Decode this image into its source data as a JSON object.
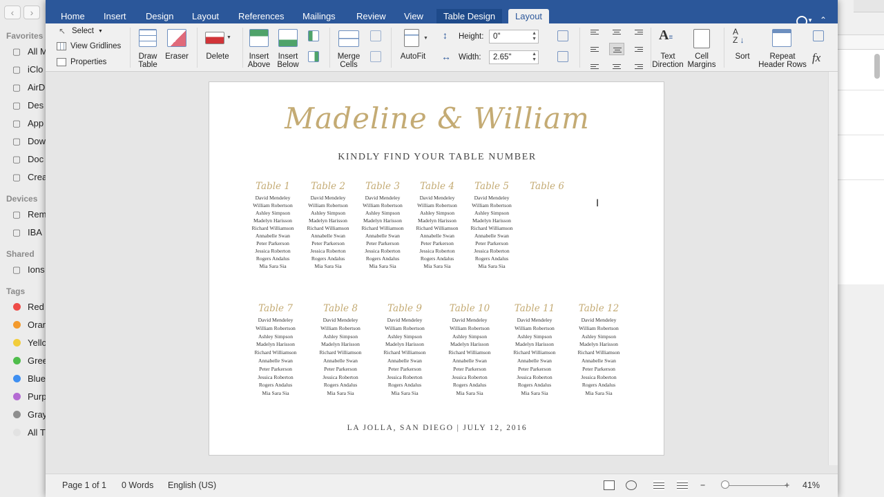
{
  "finder": {
    "sections": {
      "favorites": "Favorites",
      "devices": "Devices",
      "shared": "Shared",
      "tags": "Tags"
    },
    "favorites": [
      {
        "label": "All M",
        "icon": "all-files-icon"
      },
      {
        "label": "iClo",
        "icon": "icloud-icon"
      },
      {
        "label": "AirD",
        "icon": "airdrop-icon"
      },
      {
        "label": "Des",
        "icon": "desktop-icon"
      },
      {
        "label": "App",
        "icon": "applications-icon"
      },
      {
        "label": "Dow",
        "icon": "downloads-icon"
      },
      {
        "label": "Doc",
        "icon": "documents-icon"
      },
      {
        "label": "Crea",
        "icon": "folder-icon"
      }
    ],
    "devices": [
      {
        "label": "Rem",
        "icon": "disc-icon"
      },
      {
        "label": "IBA",
        "icon": "computer-icon"
      }
    ],
    "shared": [
      {
        "label": "Ions",
        "icon": "network-computer-icon"
      }
    ],
    "tags": [
      {
        "label": "Red",
        "color": "#ee4b47"
      },
      {
        "label": "Oran",
        "color": "#f39a2d"
      },
      {
        "label": "Yello",
        "color": "#f2cd3b"
      },
      {
        "label": "Gree",
        "color": "#4fbd4b"
      },
      {
        "label": "Blue",
        "color": "#3e8ff1"
      },
      {
        "label": "Purp",
        "color": "#b46bd3"
      },
      {
        "label": "Gray",
        "color": "#8e8e8e"
      },
      {
        "label": "All T",
        "color": "#e2e2e2"
      }
    ]
  },
  "ribbon_tabs": [
    "Home",
    "Insert",
    "Design",
    "Layout",
    "References",
    "Mailings",
    "Review",
    "View"
  ],
  "context_tabs": {
    "table_design": "Table Design",
    "layout": "Layout"
  },
  "table_group": {
    "select": "Select",
    "view_gridlines": "View Gridlines",
    "properties": "Properties"
  },
  "draw": {
    "draw_table": "Draw\nTable",
    "eraser": "Eraser"
  },
  "delete_label": "Delete",
  "insert": {
    "above": "Insert\nAbove",
    "below": "Insert\nBelow"
  },
  "merge_label": "Merge\nCells",
  "autofit_label": "AutoFit",
  "cell_size": {
    "height_label": "Height:",
    "height_value": "0\"",
    "width_label": "Width:",
    "width_value": "2.65\""
  },
  "text_direction_label": "Text\nDirection",
  "cell_margins_label": "Cell\nMargins",
  "sort_label": "Sort",
  "repeat_label": "Repeat\nHeader Rows",
  "formula_label": "fx",
  "document": {
    "couple": "Madeline & William",
    "subtitle": "KINDLY FIND YOUR TABLE NUMBER",
    "footer_location": "LA JOLLA, SAN DIEGO",
    "footer_separator": "|",
    "footer_date": "JULY 12, 2016",
    "tables": [
      {
        "title": "Table 1",
        "guests": [
          "David Mendeley",
          "William Robertson",
          "Ashley Simpson",
          "Madelyn Harisson",
          "Richard Williamson",
          "Annabelle Swan",
          "Peter Parkerson",
          "Jessica Roberton",
          "Rogers Andalus",
          "Mia Sara Sia"
        ]
      },
      {
        "title": "Table 2",
        "guests": [
          "David Mendeley",
          "William Robertson",
          "Ashley Simpson",
          "Madelyn Harisson",
          "Richard Williamson",
          "Annabelle Swan",
          "Peter Parkerson",
          "Jessica Roberton",
          "Rogers Andalus",
          "Mia Sara Sia"
        ]
      },
      {
        "title": "Table 3",
        "guests": [
          "David Mendeley",
          "William Robertson",
          "Ashley Simpson",
          "Madelyn Harisson",
          "Richard Williamson",
          "Annabelle Swan",
          "Peter Parkerson",
          "Jessica Roberton",
          "Rogers Andalus",
          "Mia Sara Sia"
        ]
      },
      {
        "title": "Table 4",
        "guests": [
          "David Mendeley",
          "William Robertson",
          "Ashley Simpson",
          "Madelyn Harisson",
          "Richard Williamson",
          "Annabelle Swan",
          "Peter Parkerson",
          "Jessica Roberton",
          "Rogers Andalus",
          "Mia Sara Sia"
        ]
      },
      {
        "title": "Table 5",
        "guests": [
          "David Mendeley",
          "William Robertson",
          "Ashley Simpson",
          "Madelyn Harisson",
          "Richard Williamson",
          "Annabelle Swan",
          "Peter Parkerson",
          "Jessica Roberton",
          "Rogers Andalus",
          "Mia Sara Sia"
        ]
      },
      {
        "title": "Table 6",
        "guests": []
      },
      {
        "title": "Table 7",
        "guests": [
          "David Mendeley",
          "William Robertson",
          "Ashley Simpson",
          "Madelyn Harisson",
          "Richard Williamson",
          "Annabelle Swan",
          "Peter Parkerson",
          "Jessica Roberton",
          "Rogers Andalus",
          "Mia Sara Sia"
        ]
      },
      {
        "title": "Table 8",
        "guests": [
          "David Mendeley",
          "William Robertson",
          "Ashley Simpson",
          "Madelyn Harisson",
          "Richard Williamson",
          "Annabelle Swan",
          "Peter Parkerson",
          "Jessica Roberton",
          "Rogers Andalus",
          "Mia Sara Sia"
        ]
      },
      {
        "title": "Table 9",
        "guests": [
          "David Mendeley",
          "William Robertson",
          "Ashley Simpson",
          "Madelyn Harisson",
          "Richard Williamson",
          "Annabelle Swan",
          "Peter Parkerson",
          "Jessica Roberton",
          "Rogers Andalus",
          "Mia Sara Sia"
        ]
      },
      {
        "title": "Table 10",
        "guests": [
          "David Mendeley",
          "William Robertson",
          "Ashley Simpson",
          "Madelyn Harisson",
          "Richard Williamson",
          "Annabelle Swan",
          "Peter Parkerson",
          "Jessica Roberton",
          "Rogers Andalus",
          "Mia Sara Sia"
        ]
      },
      {
        "title": "Table 11",
        "guests": [
          "David Mendeley",
          "William Robertson",
          "Ashley Simpson",
          "Madelyn Harisson",
          "Richard Williamson",
          "Annabelle Swan",
          "Peter Parkerson",
          "Jessica Roberton",
          "Rogers Andalus",
          "Mia Sara Sia"
        ]
      },
      {
        "title": "Table 12",
        "guests": [
          "David Mendeley",
          "William Robertson",
          "Ashley Simpson",
          "Madelyn Harisson",
          "Richard Williamson",
          "Annabelle Swan",
          "Peter Parkerson",
          "Jessica Roberton",
          "Rogers Andalus",
          "Mia Sara Sia"
        ]
      }
    ]
  },
  "statusbar": {
    "page": "Page 1 of 1",
    "words": "0 Words",
    "language": "English (US)",
    "zoom": "41%",
    "zoom_minus": "−",
    "zoom_plus": "+"
  },
  "colors": {
    "word_blue": "#2b579a",
    "gold": "#c4ab74"
  }
}
